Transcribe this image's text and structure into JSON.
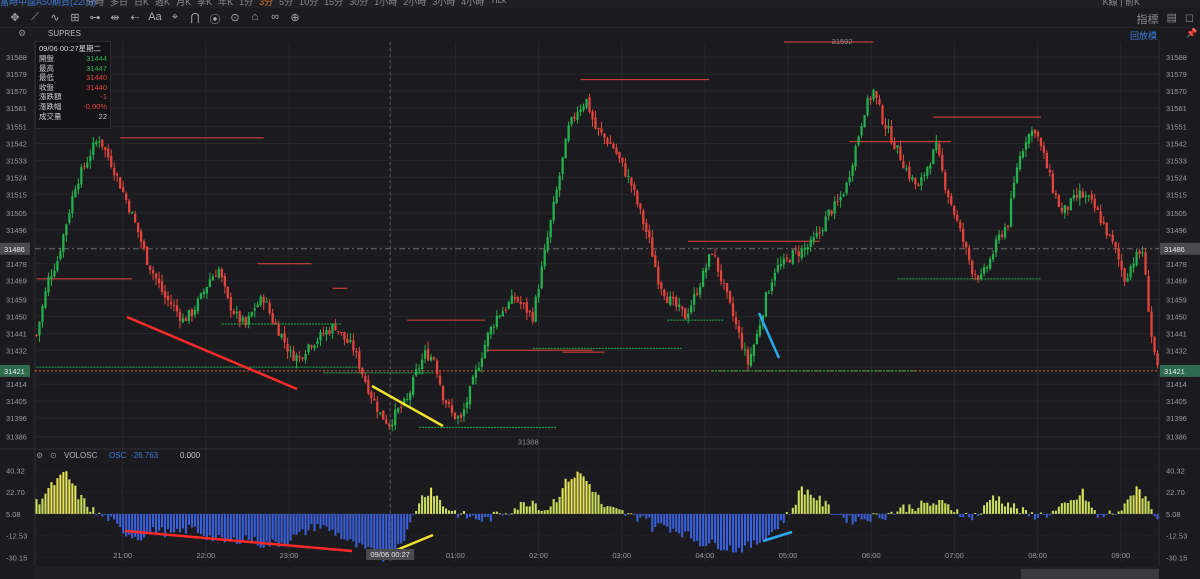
{
  "topbar": {
    "title": "富時中國A50期貨(2209)",
    "periods": [
      "分時",
      "多日",
      "日K",
      "週K",
      "月K",
      "季K",
      "年K",
      "1分",
      "3分",
      "5分",
      "10分",
      "15分",
      "30分",
      "1小時",
      "2小時",
      "3小時",
      "4小時",
      "Tick"
    ],
    "active_period": "3分",
    "right_text": "K線 | 前K"
  },
  "toolbar": {
    "tools": [
      "✥",
      "⟋",
      "∿",
      "⊞",
      "⊶",
      "⇹",
      "⇠",
      "Aa",
      "⌖",
      "⋂",
      "⦿",
      "⊙",
      "⌂",
      "∞",
      "⊕"
    ],
    "right": [
      "指標",
      "▤",
      "◻"
    ]
  },
  "main_panel": {
    "gear_icon": "⚙",
    "indicator_name": "SUPRES",
    "annotate_label": "回放模",
    "pin_icon": "📌"
  },
  "infobox": {
    "datetime": "09/06 00:27星期二",
    "rows": [
      {
        "label": "開盤",
        "value": "31444",
        "color": "#22b14c"
      },
      {
        "label": "最高",
        "value": "31447",
        "color": "#22b14c"
      },
      {
        "label": "最低",
        "value": "31440",
        "color": "#e5443c"
      },
      {
        "label": "收盤",
        "value": "31440",
        "color": "#e5443c"
      },
      {
        "label": "漲跌額",
        "value": "-1",
        "color": "#e5443c"
      },
      {
        "label": "漲跌幅",
        "value": "-0.00%",
        "color": "#e5443c"
      },
      {
        "label": "成交量",
        "value": "22",
        "color": "#c8c8d0"
      }
    ]
  },
  "osc_panel": {
    "name": "VOLOSC",
    "osc_label": "OSC",
    "osc_value": "-26.763",
    "extra_value": "0.000"
  },
  "colors": {
    "bg": "#1b1b1f",
    "up": "#22b14c",
    "down": "#e5443c",
    "resistance": "#e5443c",
    "support": "#22b14c",
    "osc_pos": "#c9dc5c",
    "osc_neg": "#3b5fd6",
    "draw_red": "#ff2a2a",
    "draw_yellow": "#f4e02e",
    "draw_blue": "#2aa9f0"
  },
  "chart_data": {
    "type": "candlestick",
    "ylim": [
      31380,
      31596
    ],
    "yticks": [
      31588,
      31579,
      31570,
      31561,
      31551,
      31542,
      31533,
      31524,
      31515,
      31505,
      31496,
      31487,
      31478,
      31469,
      31459,
      31450,
      31441,
      31432,
      31423,
      31414,
      31405,
      31396,
      31386
    ],
    "current_price": "31421",
    "crosshair_price": "31486",
    "x_labels": [
      "21:00",
      "22:00",
      "23:00",
      "09/06 00:27",
      "01:00",
      "02:00",
      "03:00",
      "04:00",
      "05:00",
      "06:00",
      "07:00",
      "08:00",
      "09:00"
    ],
    "close_path": [
      [
        0,
        31440
      ],
      [
        2,
        31455
      ],
      [
        4,
        31470
      ],
      [
        7,
        31480
      ],
      [
        10,
        31500
      ],
      [
        13,
        31520
      ],
      [
        16,
        31530
      ],
      [
        19,
        31540
      ],
      [
        21,
        31545
      ],
      [
        23,
        31538
      ],
      [
        25,
        31532
      ],
      [
        28,
        31520
      ],
      [
        31,
        31508
      ],
      [
        34,
        31495
      ],
      [
        37,
        31480
      ],
      [
        40,
        31470
      ],
      [
        43,
        31460
      ],
      [
        46,
        31455
      ],
      [
        49,
        31448
      ],
      [
        52,
        31452
      ],
      [
        55,
        31460
      ],
      [
        58,
        31470
      ],
      [
        61,
        31475
      ],
      [
        64,
        31458
      ],
      [
        67,
        31450
      ],
      [
        70,
        31445
      ],
      [
        73,
        31455
      ],
      [
        76,
        31460
      ],
      [
        79,
        31448
      ],
      [
        82,
        31440
      ],
      [
        85,
        31430
      ],
      [
        88,
        31428
      ],
      [
        91,
        31435
      ],
      [
        94,
        31438
      ],
      [
        97,
        31442
      ],
      [
        100,
        31445
      ],
      [
        103,
        31438
      ],
      [
        106,
        31433
      ],
      [
        109,
        31420
      ],
      [
        112,
        31408
      ],
      [
        115,
        31398
      ],
      [
        118,
        31393
      ],
      [
        121,
        31400
      ],
      [
        124,
        31405
      ],
      [
        127,
        31420
      ],
      [
        130,
        31430
      ],
      [
        133,
        31428
      ],
      [
        136,
        31408
      ],
      [
        139,
        31398
      ],
      [
        142,
        31395
      ],
      [
        145,
        31410
      ],
      [
        148,
        31425
      ],
      [
        151,
        31440
      ],
      [
        154,
        31450
      ],
      [
        157,
        31455
      ],
      [
        160,
        31460
      ],
      [
        163,
        31455
      ],
      [
        166,
        31450
      ],
      [
        169,
        31475
      ],
      [
        172,
        31500
      ],
      [
        175,
        31525
      ],
      [
        178,
        31550
      ],
      [
        181,
        31560
      ],
      [
        184,
        31565
      ],
      [
        187,
        31550
      ],
      [
        190,
        31545
      ],
      [
        193,
        31540
      ],
      [
        196,
        31530
      ],
      [
        199,
        31520
      ],
      [
        202,
        31505
      ],
      [
        205,
        31490
      ],
      [
        208,
        31470
      ],
      [
        211,
        31460
      ],
      [
        214,
        31455
      ],
      [
        217,
        31450
      ],
      [
        220,
        31460
      ],
      [
        223,
        31472
      ],
      [
        226,
        31485
      ],
      [
        229,
        31470
      ],
      [
        232,
        31455
      ],
      [
        235,
        31440
      ],
      [
        238,
        31425
      ],
      [
        241,
        31440
      ],
      [
        244,
        31460
      ],
      [
        247,
        31475
      ],
      [
        250,
        31478
      ],
      [
        253,
        31483
      ],
      [
        256,
        31485
      ],
      [
        259,
        31488
      ],
      [
        262,
        31495
      ],
      [
        265,
        31505
      ],
      [
        268,
        31510
      ],
      [
        271,
        31520
      ],
      [
        274,
        31540
      ],
      [
        277,
        31560
      ],
      [
        280,
        31570
      ],
      [
        283,
        31555
      ],
      [
        286,
        31545
      ],
      [
        289,
        31535
      ],
      [
        292,
        31525
      ],
      [
        295,
        31518
      ],
      [
        298,
        31530
      ],
      [
        301,
        31540
      ],
      [
        304,
        31520
      ],
      [
        307,
        31505
      ],
      [
        310,
        31490
      ],
      [
        313,
        31475
      ],
      [
        316,
        31470
      ],
      [
        319,
        31480
      ],
      [
        322,
        31492
      ],
      [
        325,
        31500
      ],
      [
        328,
        31530
      ],
      [
        331,
        31545
      ],
      [
        334,
        31550
      ],
      [
        337,
        31535
      ],
      [
        340,
        31518
      ],
      [
        343,
        31505
      ],
      [
        346,
        31510
      ],
      [
        349,
        31515
      ],
      [
        352,
        31512
      ],
      [
        355,
        31505
      ],
      [
        358,
        31495
      ],
      [
        361,
        31485
      ],
      [
        364,
        31470
      ],
      [
        367,
        31480
      ],
      [
        370,
        31485
      ],
      [
        373,
        31440
      ],
      [
        375,
        31421
      ]
    ],
    "resistance_lines": [
      {
        "p": 31545,
        "x0": 28,
        "x1": 76
      },
      {
        "p": 31470,
        "x0": 0,
        "x1": 32
      },
      {
        "p": 31478,
        "x0": 74,
        "x1": 92
      },
      {
        "p": 31465,
        "x0": 99,
        "x1": 104
      },
      {
        "p": 31448,
        "x0": 124,
        "x1": 150
      },
      {
        "p": 31432,
        "x0": 150,
        "x1": 186
      },
      {
        "p": 31576,
        "x0": 182,
        "x1": 225
      },
      {
        "p": 31490,
        "x0": 218,
        "x1": 262
      },
      {
        "p": 31543,
        "x0": 272,
        "x1": 306
      },
      {
        "p": 31556,
        "x0": 300,
        "x1": 336
      },
      {
        "p": 31431,
        "x0": 176,
        "x1": 190
      },
      {
        "p": 31596,
        "x0": 250,
        "x1": 280
      }
    ],
    "support_lines": [
      {
        "p": 31423,
        "x0": 0,
        "x1": 108
      },
      {
        "p": 31446,
        "x0": 62,
        "x1": 102
      },
      {
        "p": 31420,
        "x0": 96,
        "x1": 133
      },
      {
        "p": 31391,
        "x0": 128,
        "x1": 174
      },
      {
        "p": 31433,
        "x0": 166,
        "x1": 216
      },
      {
        "p": 31448,
        "x0": 211,
        "x1": 230
      },
      {
        "p": 31421,
        "x0": 226,
        "x1": 294
      },
      {
        "p": 31470,
        "x0": 288,
        "x1": 336
      }
    ],
    "price_labels": [
      {
        "text": "31592",
        "p": 31594,
        "x": 266
      },
      {
        "text": "31388",
        "p": 31386,
        "x": 161
      }
    ],
    "osc": {
      "ylim": [
        -34,
        44
      ],
      "yticks": [
        "40.32",
        "22.70",
        "5.08",
        "-12.53",
        "-30.15"
      ],
      "ytick_values": [
        40.32,
        22.7,
        5.08,
        -12.53,
        -30.15
      ],
      "path": [
        [
          0,
          14
        ],
        [
          6,
          30
        ],
        [
          10,
          38
        ],
        [
          14,
          20
        ],
        [
          20,
          5
        ],
        [
          24,
          2
        ],
        [
          28,
          -8
        ],
        [
          34,
          -14
        ],
        [
          40,
          -8
        ],
        [
          46,
          -12
        ],
        [
          52,
          -6
        ],
        [
          58,
          -14
        ],
        [
          64,
          -18
        ],
        [
          70,
          -14
        ],
        [
          76,
          -20
        ],
        [
          82,
          -18
        ],
        [
          88,
          -12
        ],
        [
          94,
          -4
        ],
        [
          100,
          -10
        ],
        [
          106,
          -20
        ],
        [
          112,
          -26
        ],
        [
          116,
          -30
        ],
        [
          120,
          -22
        ],
        [
          124,
          -10
        ],
        [
          128,
          16
        ],
        [
          132,
          26
        ],
        [
          136,
          12
        ],
        [
          142,
          4
        ],
        [
          146,
          2
        ],
        [
          150,
          0
        ],
        [
          156,
          6
        ],
        [
          162,
          12
        ],
        [
          166,
          16
        ],
        [
          170,
          8
        ],
        [
          174,
          18
        ],
        [
          178,
          34
        ],
        [
          182,
          38
        ],
        [
          186,
          26
        ],
        [
          190,
          10
        ],
        [
          196,
          6
        ],
        [
          200,
          2
        ],
        [
          204,
          4
        ],
        [
          206,
          -6
        ],
        [
          210,
          -4
        ],
        [
          216,
          -10
        ],
        [
          222,
          -18
        ],
        [
          228,
          -20
        ],
        [
          234,
          -24
        ],
        [
          240,
          -20
        ],
        [
          246,
          -10
        ],
        [
          252,
          6
        ],
        [
          256,
          26
        ],
        [
          260,
          20
        ],
        [
          266,
          8
        ],
        [
          272,
          0
        ],
        [
          278,
          2
        ],
        [
          284,
          4
        ],
        [
          290,
          10
        ],
        [
          296,
          12
        ],
        [
          302,
          14
        ],
        [
          308,
          8
        ],
        [
          312,
          2
        ],
        [
          316,
          6
        ],
        [
          320,
          20
        ],
        [
          326,
          12
        ],
        [
          332,
          4
        ],
        [
          336,
          4
        ],
        [
          340,
          6
        ],
        [
          346,
          14
        ],
        [
          350,
          22
        ],
        [
          355,
          2
        ],
        [
          360,
          6
        ],
        [
          364,
          10
        ],
        [
          368,
          28
        ],
        [
          372,
          14
        ],
        [
          375,
          2
        ]
      ]
    }
  }
}
